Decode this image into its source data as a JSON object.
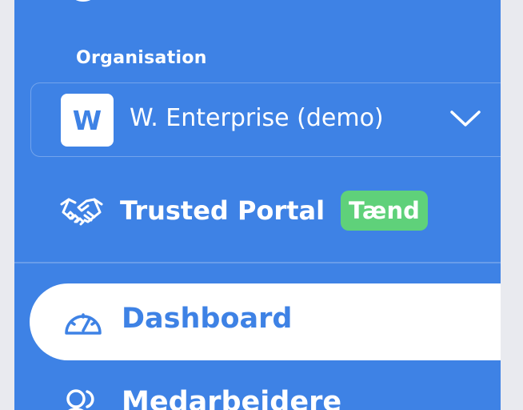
{
  "sidebar": {
    "section_label": "Organisation",
    "organisation": {
      "logo_letter": "W",
      "name": "W. Enterprise (demo)",
      "icon": "chevron-down-icon"
    },
    "trusted_portal": {
      "icon": "handshake-icon",
      "label": "Trusted Portal",
      "badge": "Tænd",
      "badge_color": "#5fd17a"
    },
    "nav": [
      {
        "label": "Dashboard",
        "icon": "gauge-icon",
        "active": true
      },
      {
        "label": "Medarbejdere",
        "icon": "users-icon",
        "active": false
      }
    ]
  },
  "colors": {
    "brand": "#3e82e5",
    "background": "#e9eaef",
    "active_bg": "#ffffff"
  }
}
